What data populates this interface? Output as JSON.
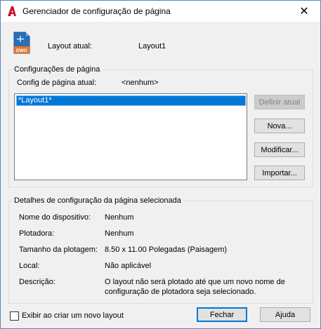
{
  "window": {
    "title": "Gerenciador de configuração de página",
    "close_glyph": "✕"
  },
  "layout": {
    "label": "Layout atual:",
    "value": "Layout1",
    "icon_text": "DWG"
  },
  "page_setups": {
    "group_title": "Configurações de página",
    "current_label": "Config de página atual:",
    "current_value": "<nenhum>",
    "list_items": [
      "*Layout1*"
    ],
    "selected_index": 0
  },
  "buttons": {
    "set_current": "Definir atual",
    "new": "Nova...",
    "modify": "Modificar...",
    "import": "Importar...",
    "close": "Fechar",
    "help": "Ajuda"
  },
  "details": {
    "group_title": "Detalhes de configuração da página selecionada",
    "rows": [
      {
        "label": "Nome do dispositivo:",
        "value": "Nenhum"
      },
      {
        "label": "Plotadora:",
        "value": "Nenhum"
      },
      {
        "label": "Tamanho da plotagem:",
        "value": "8.50 x 11.00 Polegadas (Paisagem)"
      },
      {
        "label": "Local:",
        "value": "Não aplicável"
      },
      {
        "label": "Descrição:",
        "value_line1": "O layout não será plotado até que um novo nome de",
        "value_line2": "configuração de plotadora seja selecionado."
      }
    ]
  },
  "footer": {
    "checkbox_label": "Exibir ao criar um novo layout",
    "checkbox_checked": false
  },
  "colors": {
    "selection": "#0078d7",
    "app_icon": "#c8102e",
    "dwg_blue": "#1a5fb4",
    "dwg_orange": "#e87722"
  }
}
